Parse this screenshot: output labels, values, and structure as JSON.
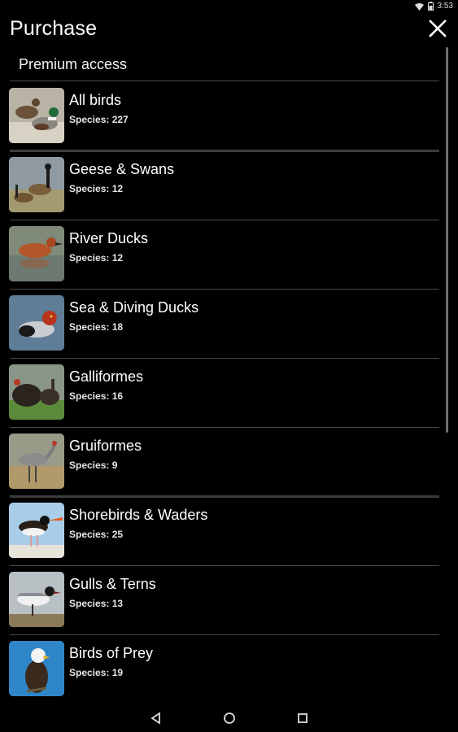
{
  "status_bar": {
    "time": "3:53",
    "icons": [
      "wifi-icon",
      "battery-icon"
    ]
  },
  "app_bar": {
    "title": "Purchase",
    "close_icon": "close-icon"
  },
  "section_header": "Premium access",
  "species_prefix": "Species: ",
  "items": [
    {
      "title": "All birds",
      "species": "227",
      "thumb": "mallard-ducks"
    },
    {
      "title": "Geese & Swans",
      "species": "12",
      "thumb": "canada-geese"
    },
    {
      "title": "River Ducks",
      "species": "12",
      "thumb": "cinnamon-teal"
    },
    {
      "title": "Sea & Diving Ducks",
      "species": "18",
      "thumb": "redhead-duck"
    },
    {
      "title": "Galliformes",
      "species": "16",
      "thumb": "turkeys"
    },
    {
      "title": "Gruiformes",
      "species": "9",
      "thumb": "crane"
    },
    {
      "title": "Shorebirds & Waders",
      "species": "25",
      "thumb": "oystercatcher"
    },
    {
      "title": "Gulls & Terns",
      "species": "13",
      "thumb": "gull"
    },
    {
      "title": "Birds of Prey",
      "species": "19",
      "thumb": "bald-eagle"
    }
  ],
  "nav_bar": {
    "icons": [
      "back-icon",
      "home-icon",
      "recents-icon"
    ]
  },
  "colors": {
    "background": "#000000",
    "text": "#ffffff",
    "divider": "#4a4a4a"
  }
}
